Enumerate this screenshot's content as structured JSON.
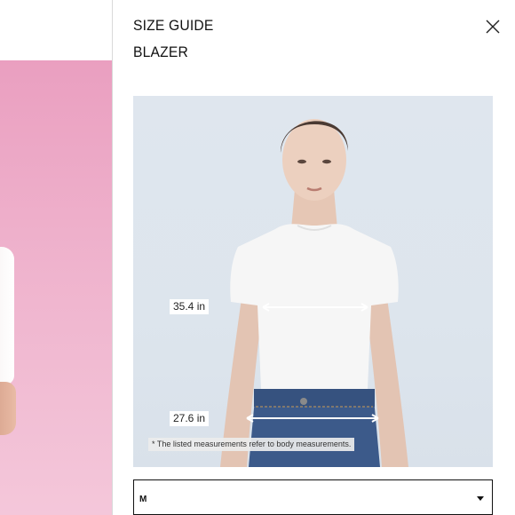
{
  "size_guide": {
    "title": "SIZE GUIDE",
    "product_name": "BLAZER",
    "close_icon": "close-icon"
  },
  "measurements": {
    "chest": "35.4 in",
    "waist": "27.6 in",
    "disclaimer": "* The listed measurements refer to body measurements."
  },
  "size_select": {
    "selected": "M",
    "icon": "caret-down-icon"
  },
  "colors": {
    "background_photo": "#ea9fc0",
    "image_backdrop": "#dfe6ee",
    "text": "#111111"
  }
}
